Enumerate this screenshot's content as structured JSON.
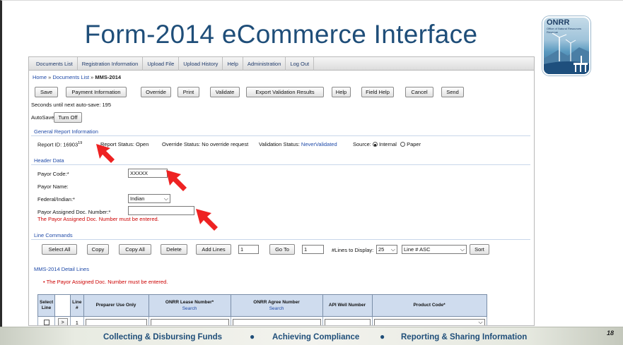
{
  "slide": {
    "title": "Form-2014 eCommerce Interface",
    "page_number": "18",
    "footer": [
      "Collecting & Disbursing Funds",
      "Achieving Compliance",
      "Reporting & Sharing Information"
    ],
    "bullet": "●",
    "logo_text": "ONRR",
    "logo_subtext": "Office of Natural Resources Revenue",
    "colors": {
      "title": "#1f4e79",
      "link": "#1f4aa8",
      "error": "#cc0000",
      "arrow": "#ee2222"
    }
  },
  "nav": {
    "items": [
      "Documents List",
      "Registration Information",
      "Upload File",
      "Upload History",
      "Help",
      "Administration",
      "Log Out"
    ]
  },
  "breadcrumb": {
    "home": "Home",
    "documents": "Documents List",
    "current": "MMS-2014",
    "separator": "»"
  },
  "toolbar": {
    "save": "Save",
    "payment": "Payment Information",
    "override": "Override",
    "print": "Print",
    "validate": "Validate",
    "export": "Export Validation Results",
    "help": "Help",
    "field_help": "Field Help",
    "cancel": "Cancel",
    "send": "Send"
  },
  "autosave": {
    "countdown": "Seconds until next auto-save: 195",
    "label": "AutoSave:",
    "toggle": "Turn Off"
  },
  "general": {
    "heading": "General Report Information",
    "report_id_label": "Report ID:",
    "report_id": "16903",
    "report_id_suffix": "19",
    "report_status_label": "Report Status:",
    "report_status": "Open",
    "override_label": "Override Status:",
    "override": "No override request",
    "validation_label": "Validation Status:",
    "validation": "NeverValidated",
    "source_label": "Source:",
    "source_internal": "Internal",
    "source_paper": "Paper"
  },
  "header": {
    "heading": "Header Data",
    "payor_code_label": "Payor Code:*",
    "payor_code": "XXXXX",
    "payor_name_label": "Payor Name:",
    "federal_label": "Federal/Indian:*",
    "federal_value": "Indian",
    "doc_number_label": "Payor Assigned Doc. Number:*",
    "doc_number_value": "",
    "doc_error": "The Payor Assigned Doc. Number must be entered."
  },
  "line_commands": {
    "heading": "Line Commands",
    "select_all": "Select All",
    "copy": "Copy",
    "copy_all": "Copy All",
    "delete": "Delete",
    "add_lines": "Add Lines",
    "add_count": "1",
    "go_to": "Go To",
    "go_to_value": "1",
    "lines_to_display_label": "#Lines to Display:",
    "lines_to_display": "25",
    "sort_field": "Line # ASC",
    "sort": "Sort"
  },
  "detail": {
    "heading": "MMS-2014 Detail Lines",
    "error": "The Payor Assigned Doc. Number must be entered.",
    "error_bullet": "•",
    "columns": {
      "select": [
        "Select",
        "Line"
      ],
      "line": [
        "Line",
        "#"
      ],
      "preparer": "Preparer Use Only",
      "lease": "ONRR Lease Number*",
      "agree": "ONRR Agree Number",
      "search": "Search",
      "api": "API Well Number",
      "product": "Product Code*"
    },
    "rows": [
      {
        "goto": ">",
        "line": "1"
      }
    ]
  }
}
